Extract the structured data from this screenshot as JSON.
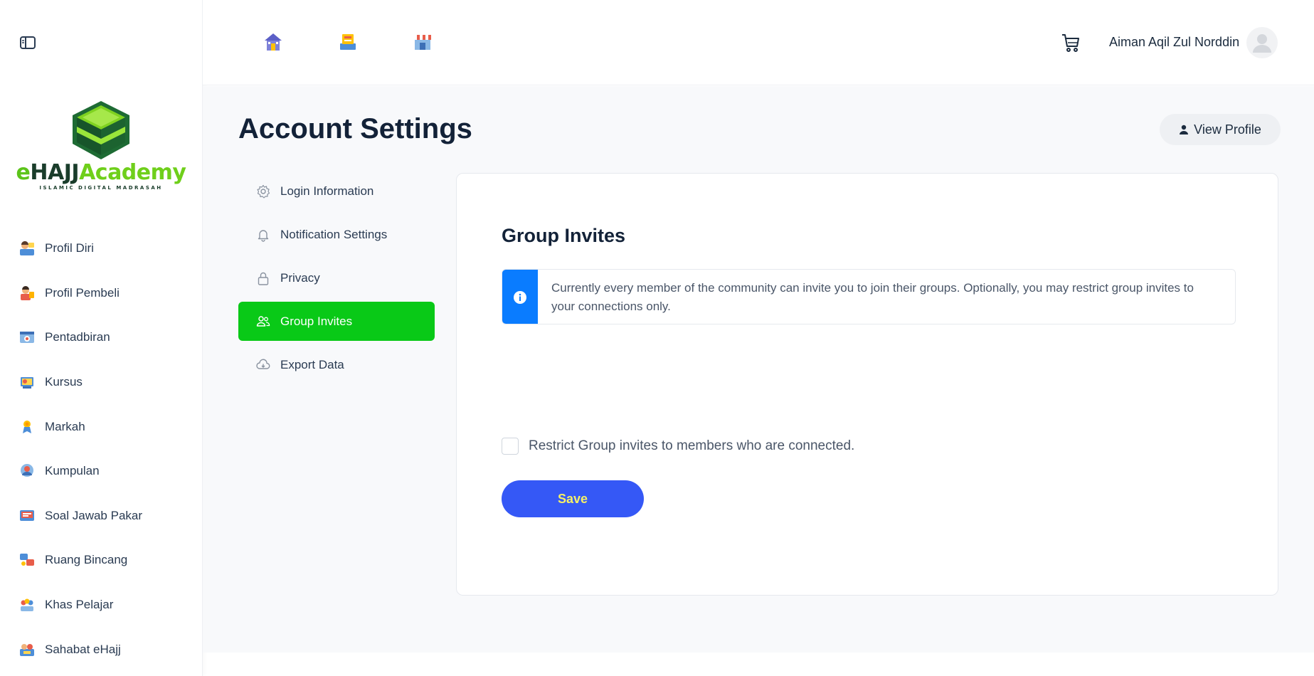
{
  "brand": {
    "logo_text_e": "e",
    "logo_text_hajj": "HAJJ",
    "logo_text_academy": "Academy",
    "logo_subtitle": "ISLAMIC DIGITAL MADRASAH"
  },
  "sidebar": {
    "items": [
      {
        "label": "Profil Diri",
        "icon": "profile-icon"
      },
      {
        "label": "Profil Pembeli",
        "icon": "buyer-profile-icon"
      },
      {
        "label": "Pentadbiran",
        "icon": "administration-icon"
      },
      {
        "label": "Kursus",
        "icon": "course-icon"
      },
      {
        "label": "Markah",
        "icon": "marks-icon"
      },
      {
        "label": "Kumpulan",
        "icon": "group-icon"
      },
      {
        "label": "Soal Jawab Pakar",
        "icon": "expert-qa-icon"
      },
      {
        "label": "Ruang Bincang",
        "icon": "discussion-icon"
      },
      {
        "label": "Khas Pelajar",
        "icon": "student-special-icon"
      },
      {
        "label": "Sahabat eHajj",
        "icon": "ehajj-friends-icon"
      }
    ]
  },
  "header": {
    "icons": [
      "mosque-home-icon",
      "book-icon",
      "store-icon",
      "cart-icon"
    ],
    "user_name": "Aiman Aqil Zul Norddin"
  },
  "page": {
    "title": "Account Settings",
    "view_profile_label": "View Profile"
  },
  "settings_menu": {
    "items": [
      {
        "label": "Login Information",
        "icon": "gear-icon",
        "active": false
      },
      {
        "label": "Notification Settings",
        "icon": "bell-icon",
        "active": false
      },
      {
        "label": "Privacy",
        "icon": "lock-icon",
        "active": false
      },
      {
        "label": "Group Invites",
        "icon": "users-icon",
        "active": true
      },
      {
        "label": "Export Data",
        "icon": "cloud-download-icon",
        "active": false
      }
    ]
  },
  "panel": {
    "title": "Group Invites",
    "notice_text": "Currently every member of the community can invite you to join their groups. Optionally, you may restrict group invites to your connections only.",
    "checkbox_label": "Restrict Group invites to members who are connected.",
    "checkbox_checked": false,
    "save_label": "Save"
  },
  "colors": {
    "active_menu": "#09c917",
    "save_button": "#3558f6",
    "save_text": "#f5f067",
    "info_bar": "#0a7cff"
  }
}
